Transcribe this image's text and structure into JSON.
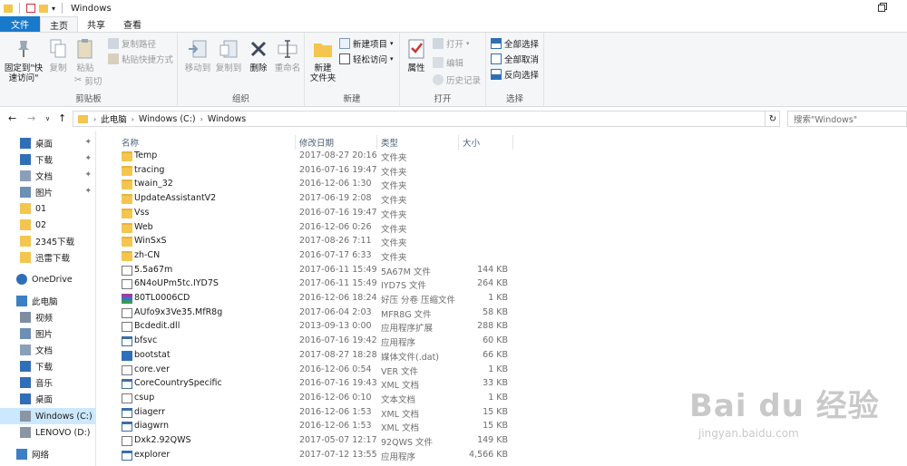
{
  "window": {
    "title": "Windows"
  },
  "tabs": [
    "文件",
    "主页",
    "共享",
    "查看"
  ],
  "ribbon": {
    "clipboard": {
      "label": "剪贴板",
      "pin": "固定到\"快速访问\"",
      "copy": "复制",
      "paste": "粘贴",
      "copy_path": "复制路径",
      "paste_shortcut": "粘贴快捷方式",
      "cut": "剪切"
    },
    "organize": {
      "label": "组织",
      "move_to": "移动到",
      "copy_to": "复制到",
      "delete": "删除",
      "rename": "重命名"
    },
    "new": {
      "label": "新建",
      "new_folder": "新建\n文件夹",
      "new_item": "新建项目",
      "easy_access": "轻松访问"
    },
    "open": {
      "label": "打开",
      "properties": "属性",
      "open": "打开",
      "edit": "编辑",
      "history": "历史记录"
    },
    "select": {
      "label": "选择",
      "select_all": "全部选择",
      "select_none": "全部取消",
      "invert": "反向选择"
    }
  },
  "address": {
    "crumbs": [
      "此电脑",
      "Windows (C:)",
      "Windows"
    ],
    "search_placeholder": "搜索\"Windows\""
  },
  "nav": [
    {
      "label": "桌面",
      "icon": "desktop-icon",
      "pinned": true
    },
    {
      "label": "下载",
      "icon": "download-icon",
      "pinned": true
    },
    {
      "label": "文档",
      "icon": "document-icon",
      "pinned": true
    },
    {
      "label": "图片",
      "icon": "picture-icon",
      "pinned": true
    },
    {
      "label": "01",
      "icon": "folder-icon",
      "pinned": false
    },
    {
      "label": "02",
      "icon": "folder-icon",
      "pinned": false
    },
    {
      "label": "2345下载",
      "icon": "folder-icon",
      "pinned": false
    },
    {
      "label": "迅雷下载",
      "icon": "folder-icon",
      "pinned": false
    },
    {
      "label": "OneDrive",
      "icon": "cloud-icon",
      "pinned": false
    },
    {
      "label": "此电脑",
      "icon": "computer-icon",
      "pinned": false
    },
    {
      "label": "视频",
      "icon": "video-icon",
      "pinned": false
    },
    {
      "label": "图片",
      "icon": "picture-icon",
      "pinned": false
    },
    {
      "label": "文档",
      "icon": "document-icon",
      "pinned": false
    },
    {
      "label": "下载",
      "icon": "download-icon",
      "pinned": false
    },
    {
      "label": "音乐",
      "icon": "music-icon",
      "pinned": false
    },
    {
      "label": "桌面",
      "icon": "desktop-icon",
      "pinned": false
    },
    {
      "label": "Windows (C:)",
      "icon": "drive-icon",
      "pinned": false,
      "selected": true
    },
    {
      "label": "LENOVO (D:)",
      "icon": "drive-icon",
      "pinned": false
    },
    {
      "label": "网络",
      "icon": "network-icon",
      "pinned": false
    }
  ],
  "columns": {
    "name": "名称",
    "date": "修改日期",
    "type": "类型",
    "size": "大小"
  },
  "files": [
    {
      "name": "Temp",
      "date": "2017-08-27 20:16",
      "type": "文件夹",
      "size": "",
      "icon": "folder"
    },
    {
      "name": "tracing",
      "date": "2016-07-16 19:47",
      "type": "文件夹",
      "size": "",
      "icon": "folder"
    },
    {
      "name": "twain_32",
      "date": "2016-12-06 1:30",
      "type": "文件夹",
      "size": "",
      "icon": "folder"
    },
    {
      "name": "UpdateAssistantV2",
      "date": "2017-06-19 2:08",
      "type": "文件夹",
      "size": "",
      "icon": "folder"
    },
    {
      "name": "Vss",
      "date": "2016-07-16 19:47",
      "type": "文件夹",
      "size": "",
      "icon": "folder"
    },
    {
      "name": "Web",
      "date": "2016-12-06 0:26",
      "type": "文件夹",
      "size": "",
      "icon": "folder"
    },
    {
      "name": "WinSxS",
      "date": "2017-08-26 7:11",
      "type": "文件夹",
      "size": "",
      "icon": "folder"
    },
    {
      "name": "zh-CN",
      "date": "2016-07-17 6:33",
      "type": "文件夹",
      "size": "",
      "icon": "folder"
    },
    {
      "name": "5.5a67m",
      "date": "2017-06-11 15:49",
      "type": "5A67M 文件",
      "size": "144 KB",
      "icon": "doc"
    },
    {
      "name": "6N4oUPm5tc.IYD7S",
      "date": "2017-06-11 15:49",
      "type": "IYD7S 文件",
      "size": "264 KB",
      "icon": "doc"
    },
    {
      "name": "80TL0006CD",
      "date": "2016-12-06 18:24",
      "type": "好压 分卷 压缩文件",
      "size": "1 KB",
      "icon": "rar"
    },
    {
      "name": "AUfo9x3Ve35.MfR8g",
      "date": "2017-06-04 2:03",
      "type": "MFR8G 文件",
      "size": "58 KB",
      "icon": "doc"
    },
    {
      "name": "Bcdedit.dll",
      "date": "2013-09-13 0:00",
      "type": "应用程序扩展",
      "size": "288 KB",
      "icon": "doc"
    },
    {
      "name": "bfsvc",
      "date": "2016-07-16 19:42",
      "type": "应用程序",
      "size": "60 KB",
      "icon": "exe"
    },
    {
      "name": "bootstat",
      "date": "2017-08-27 18:28",
      "type": "媒体文件(.dat)",
      "size": "66 KB",
      "icon": "media"
    },
    {
      "name": "core.ver",
      "date": "2016-12-06 0:54",
      "type": "VER 文件",
      "size": "1 KB",
      "icon": "doc"
    },
    {
      "name": "CoreCountrySpecific",
      "date": "2016-07-16 19:43",
      "type": "XML 文档",
      "size": "33 KB",
      "icon": "exe"
    },
    {
      "name": "csup",
      "date": "2016-12-06 0:10",
      "type": "文本文档",
      "size": "1 KB",
      "icon": "doc"
    },
    {
      "name": "diagerr",
      "date": "2016-12-06 1:53",
      "type": "XML 文档",
      "size": "15 KB",
      "icon": "exe"
    },
    {
      "name": "diagwrn",
      "date": "2016-12-06 1:53",
      "type": "XML 文档",
      "size": "15 KB",
      "icon": "exe"
    },
    {
      "name": "Dxk2.92QWS",
      "date": "2017-05-07 12:17",
      "type": "92QWS 文件",
      "size": "149 KB",
      "icon": "doc"
    },
    {
      "name": "explorer",
      "date": "2017-07-12 13:55",
      "type": "应用程序",
      "size": "4,566 KB",
      "icon": "exe"
    }
  ],
  "watermark": {
    "brand": "Bai du 经验",
    "url": "jingyan.baidu.com"
  }
}
